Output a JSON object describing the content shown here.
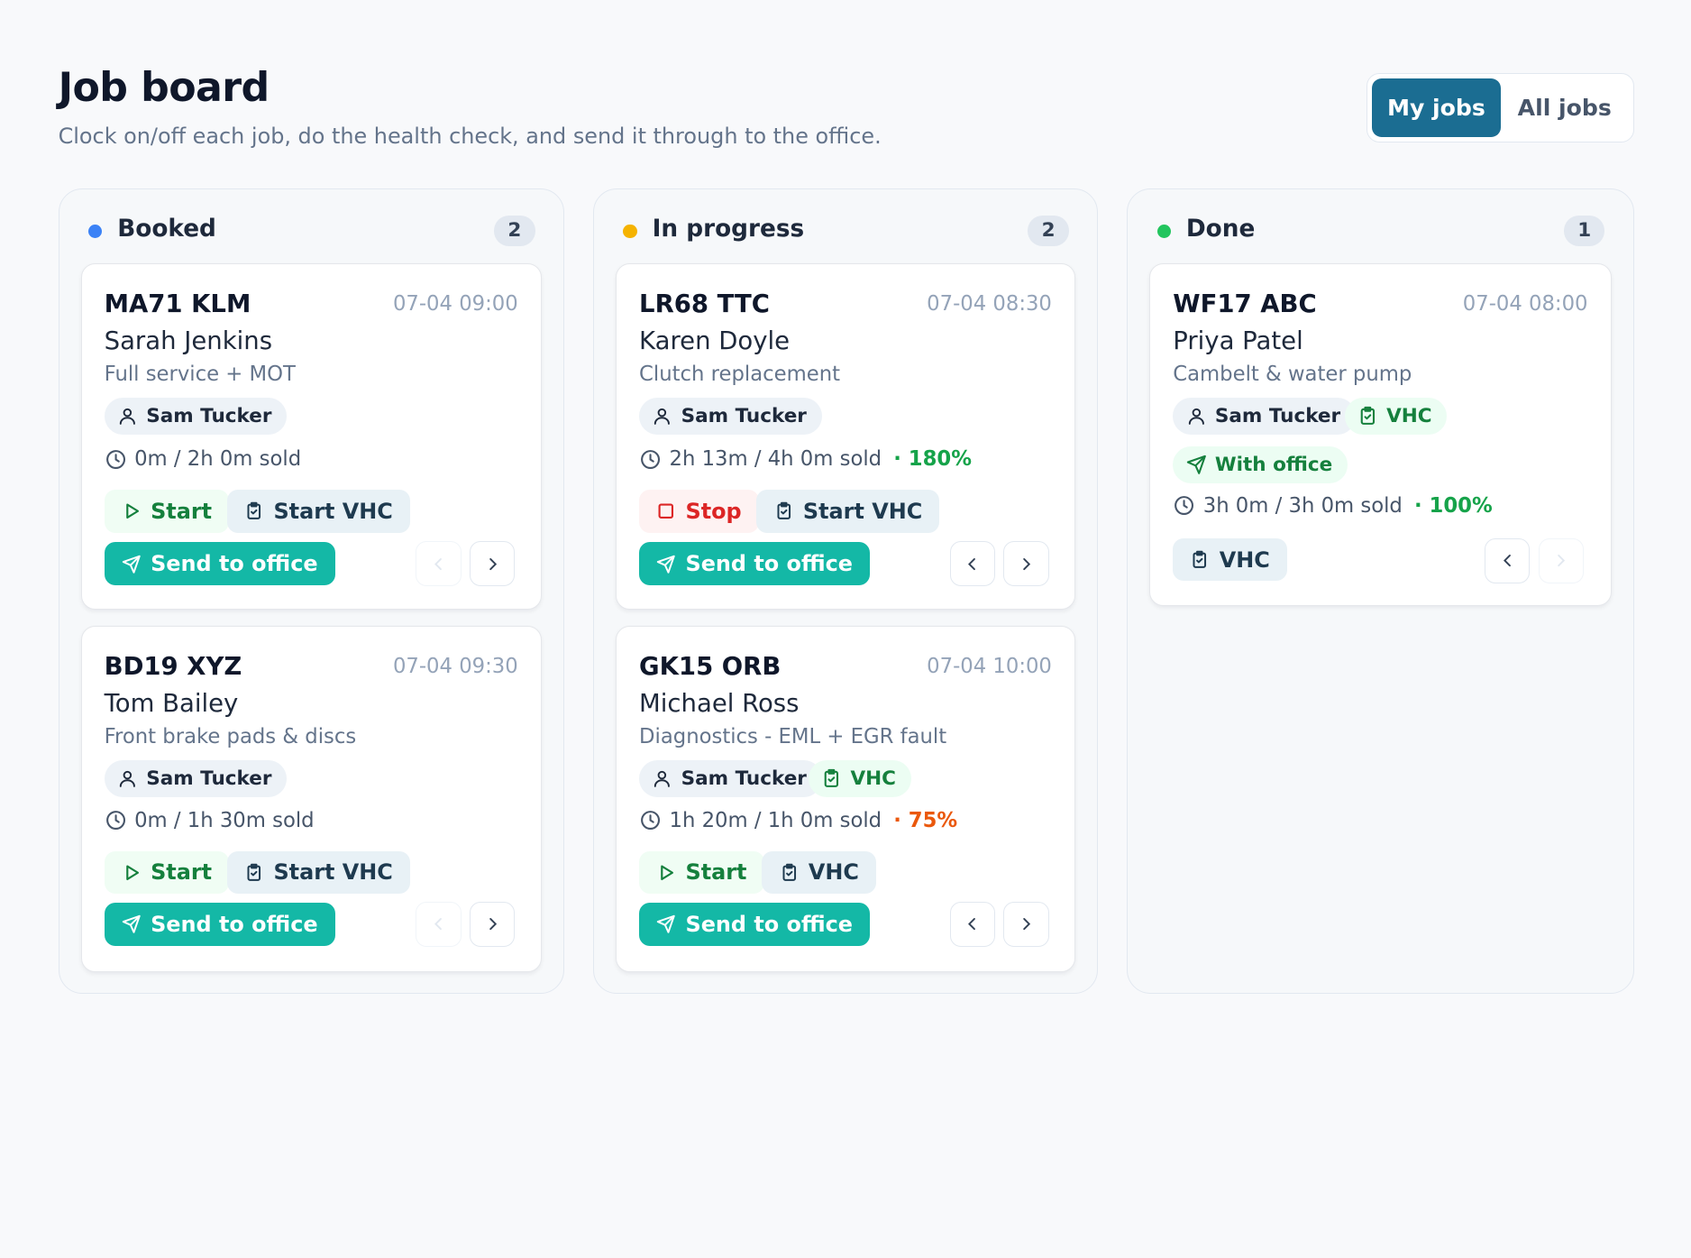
{
  "header": {
    "title": "Job board",
    "subtitle": "Clock on/off each job, do the health check, and send it through to the office."
  },
  "toggle": {
    "my_jobs": "My jobs",
    "all_jobs": "All jobs"
  },
  "colors": {
    "booked": "#3b82f6",
    "in_progress": "#f5b300",
    "done": "#22c55e",
    "accent": "#1b6d92",
    "send": "#14b8a6"
  },
  "columns": [
    {
      "title": "Booked",
      "count": "2",
      "cards": [
        {
          "plate": "MA71 KLM",
          "date": "07-04 09:00",
          "customer": "Sarah Jenkins",
          "job": "Full service + MOT",
          "tech": "Sam Tucker",
          "time": "0m / 2h 0m sold",
          "buttons": {
            "primary": "Start",
            "vhc": "Start VHC",
            "send": "Send to office"
          }
        },
        {
          "plate": "BD19 XYZ",
          "date": "07-04 09:30",
          "customer": "Tom Bailey",
          "job": "Front brake pads & discs",
          "tech": "Sam Tucker",
          "time": "0m / 1h 30m sold",
          "buttons": {
            "primary": "Start",
            "vhc": "Start VHC",
            "send": "Send to office"
          }
        }
      ]
    },
    {
      "title": "In progress",
      "count": "2",
      "cards": [
        {
          "plate": "LR68 TTC",
          "date": "07-04 08:30",
          "customer": "Karen Doyle",
          "job": "Clutch replacement",
          "tech": "Sam Tucker",
          "time": "2h 13m / 4h 0m sold",
          "pct": "· 180%",
          "buttons": {
            "primary": "Stop",
            "vhc": "Start VHC",
            "send": "Send to office"
          }
        },
        {
          "plate": "GK15 ORB",
          "date": "07-04 10:00",
          "customer": "Michael Ross",
          "job": "Diagnostics - EML + EGR fault",
          "tech": "Sam Tucker",
          "vhc_badge": "VHC",
          "time": "1h 20m / 1h 0m sold",
          "pct": "· 75%",
          "buttons": {
            "primary": "Start",
            "vhc": "VHC",
            "send": "Send to office"
          }
        }
      ]
    },
    {
      "title": "Done",
      "count": "1",
      "cards": [
        {
          "plate": "WF17 ABC",
          "date": "07-04 08:00",
          "customer": "Priya Patel",
          "job": "Cambelt & water pump",
          "tech": "Sam Tucker",
          "vhc_badge": "VHC",
          "status": "With office",
          "time": "3h 0m / 3h 0m sold",
          "pct": "· 100%",
          "buttons": {
            "vhc": "VHC"
          }
        }
      ]
    }
  ]
}
